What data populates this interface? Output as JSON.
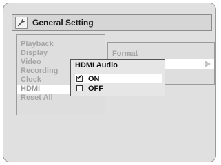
{
  "header": {
    "title": "General Setting",
    "icon": "wrench-icon"
  },
  "menu": {
    "items": [
      "Playback",
      "Display",
      "Video",
      "Recording",
      "Clock",
      "HDMI",
      "Reset All"
    ],
    "selected_index": 5
  },
  "submenu": {
    "label": "Format",
    "arrow_icon": "right-arrow-icon"
  },
  "popup": {
    "title": "HDMI Audio",
    "options": [
      {
        "label": "ON",
        "checked": true
      },
      {
        "label": "OFF",
        "checked": false
      }
    ]
  },
  "colors": {
    "accent": "#ffffff",
    "background": "#e0e0e0",
    "text_dim": "#a4a4a4"
  }
}
